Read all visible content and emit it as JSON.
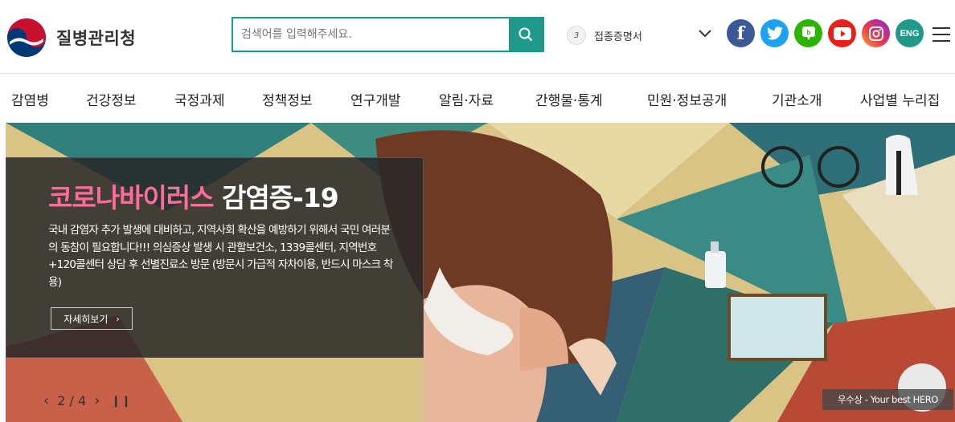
{
  "header": {
    "logo_text": "질병관리청",
    "search": {
      "placeholder": "검색어를 입력해주세요."
    },
    "popular": {
      "rank": "3",
      "keyword": "접종증명서"
    },
    "social": [
      {
        "name": "facebook-icon",
        "glyph": "f"
      },
      {
        "name": "twitter-icon",
        "glyph": ""
      },
      {
        "name": "blog-icon",
        "glyph": ""
      },
      {
        "name": "youtube-icon",
        "glyph": ""
      },
      {
        "name": "instagram-icon",
        "glyph": ""
      }
    ],
    "eng_label": "ENG"
  },
  "nav": {
    "items": [
      "감염병",
      "건강정보",
      "국정과제",
      "정책정보",
      "연구개발",
      "알림·자료",
      "간행물·통계",
      "민원·정보공개",
      "기관소개",
      "사업별 누리집"
    ]
  },
  "hero": {
    "title_pink": "코로나바이러스",
    "title_white": "감염증-19",
    "description": "국내 감염자 추가 발생에 대비하고, 지역사회 확산을 예방하기 위해서 국민 여러분의 동참이 필요합니다!!! 의심증상 발생 시 관할보건소, 1339콜센터, 지역번호+120콜센터 상담 후 선별진료소 방문 (방문시 가급적 자차이용, 반드시 마스크 착용)",
    "more_label": "자세히보기",
    "pager": {
      "current": "2",
      "separator": "/",
      "total": "4"
    },
    "caption": "우수상 - Your best HERO"
  },
  "colors": {
    "brand_teal": "#1f9a8a",
    "title_pink": "#ff6b9a"
  }
}
